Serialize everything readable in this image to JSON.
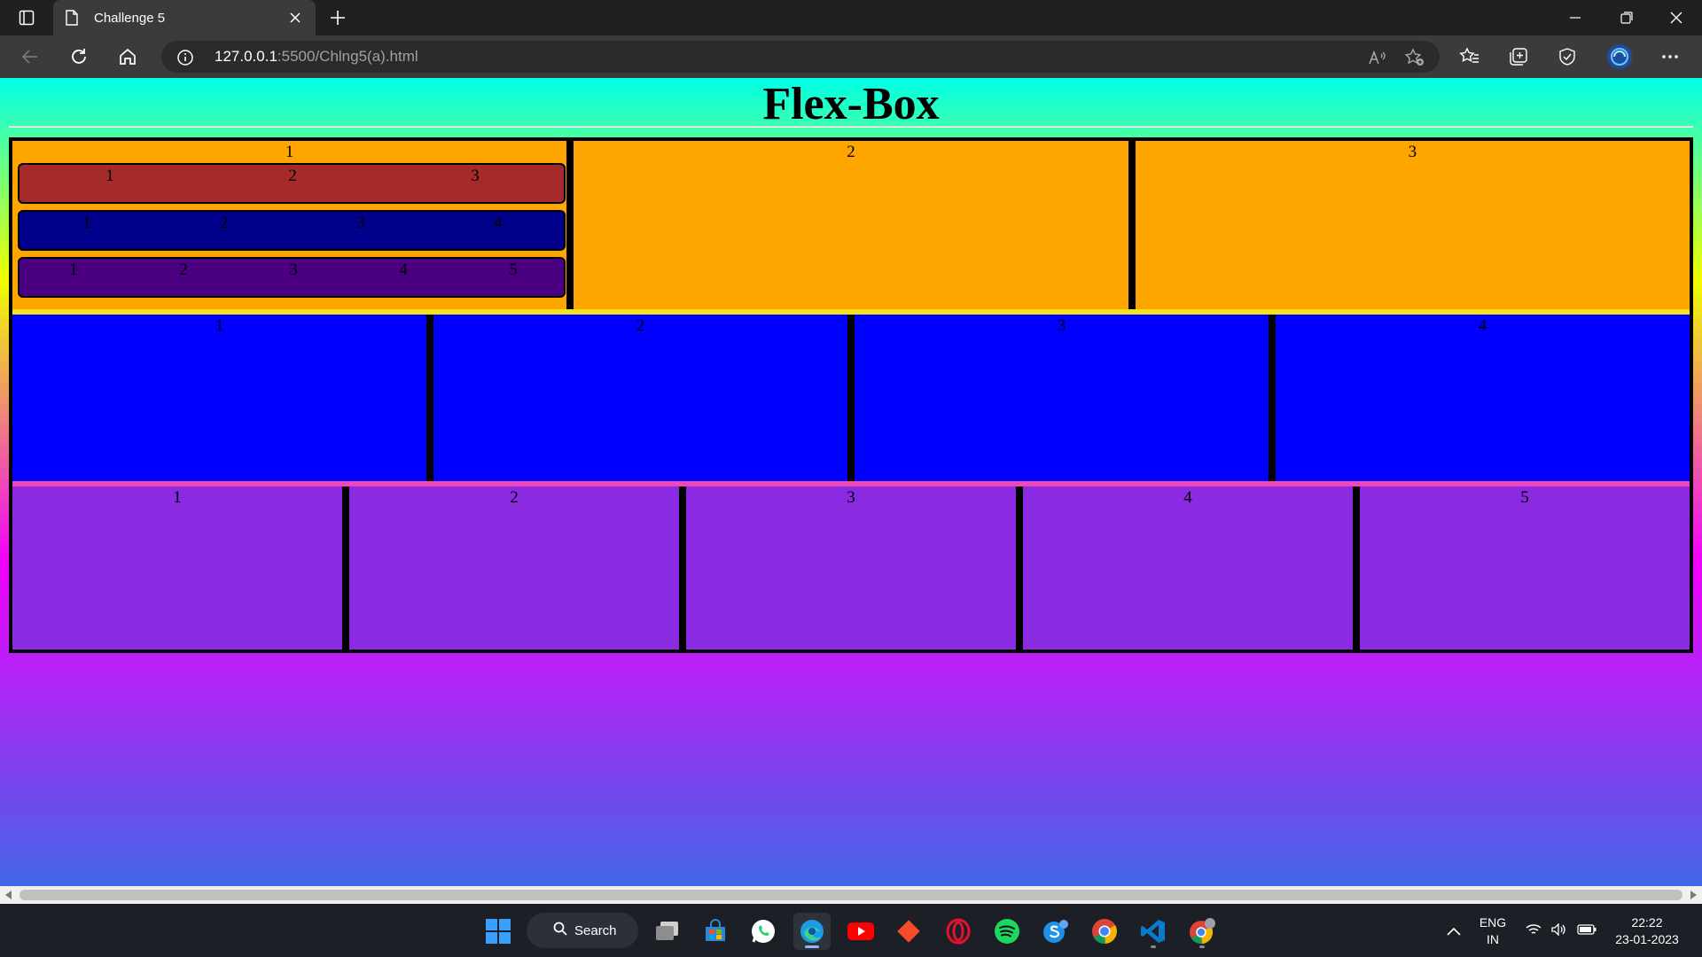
{
  "browser": {
    "tab_title": "Challenge 5",
    "url_host": "127.0.0.1",
    "url_rest": ":5500/Chlng5(a).html"
  },
  "page": {
    "title": "Flex-Box",
    "rows": [
      {
        "color": "#ffa500",
        "cells": [
          {
            "label": "1",
            "nested": [
              {
                "color": "#a52a2a",
                "labels": [
                  "1",
                  "2",
                  "3"
                ]
              },
              {
                "color": "#00008b",
                "labels": [
                  "1",
                  "2",
                  "3",
                  "4"
                ]
              },
              {
                "color": "#4b0082",
                "labels": [
                  "1",
                  "2",
                  "3",
                  "4",
                  "5"
                ]
              }
            ]
          },
          {
            "label": "2"
          },
          {
            "label": "3"
          }
        ]
      },
      {
        "color": "#0000ff",
        "cells": [
          {
            "label": "1"
          },
          {
            "label": "2"
          },
          {
            "label": "3"
          },
          {
            "label": "4"
          }
        ]
      },
      {
        "color": "#8a2be2",
        "cells": [
          {
            "label": "1"
          },
          {
            "label": "2"
          },
          {
            "label": "3"
          },
          {
            "label": "4"
          },
          {
            "label": "5"
          }
        ]
      }
    ]
  },
  "taskbar": {
    "search_label": "Search",
    "apps": [
      "start-icon",
      "search",
      "task-view-icon",
      "microsoft-store-icon",
      "whatsapp-icon",
      "edge-icon",
      "youtube-icon",
      "git-icon",
      "opera-icon",
      "spotify-icon",
      "skype-icon",
      "chrome-icon",
      "vscode-icon",
      "chrome-profile-icon"
    ],
    "language_line1": "ENG",
    "language_line2": "IN",
    "time": "22:22",
    "date": "23-01-2023"
  }
}
